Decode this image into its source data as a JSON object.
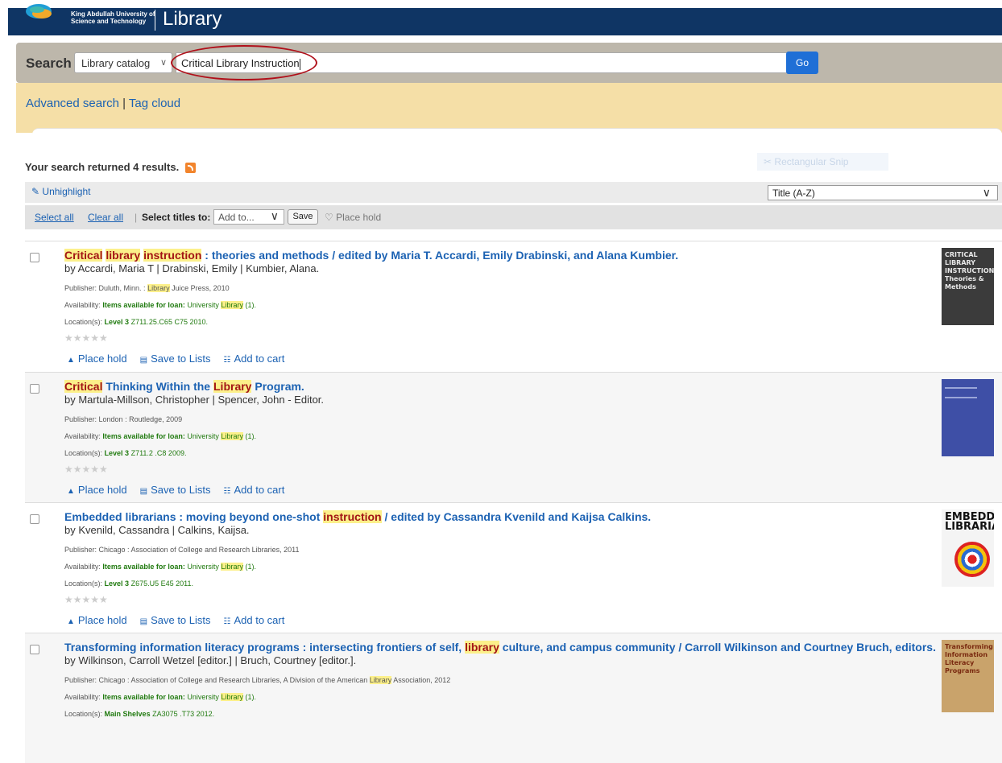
{
  "header": {
    "university": [
      "King Abdullah University of",
      "Science and Technology"
    ],
    "title": "Library"
  },
  "search": {
    "label": "Search",
    "scope": "Library catalog",
    "query": "Critical Library Instruction",
    "go_label": "Go"
  },
  "subnav": {
    "advanced": "Advanced search",
    "separator": "|",
    "tag_cloud": "Tag cloud"
  },
  "results_summary": "Your search returned 4 results.",
  "faded_overlay_text": "Rectangular Snip",
  "toolbar": {
    "unhighlight": "Unhighlight",
    "sort": "Title (A-Z)",
    "select_all": "Select all",
    "clear_all": "Clear all",
    "select_titles_to": "Select titles to:",
    "add_to": "Add to...",
    "save": "Save",
    "place_hold": "Place hold"
  },
  "actions": {
    "place_hold": "Place hold",
    "save_to_lists": "Save to Lists",
    "add_to_cart": "Add to cart"
  },
  "results": [
    {
      "title_parts": [
        {
          "t": "Critical",
          "hl": true
        },
        {
          "t": " ",
          "hl": false
        },
        {
          "t": "library",
          "hl": true
        },
        {
          "t": " ",
          "hl": false
        },
        {
          "t": "instruction",
          "hl": true
        },
        {
          "t": " : theories and methods / edited by Maria T. Accardi, Emily Drabinski, and Alana Kumbier.",
          "hl": false
        }
      ],
      "by": "by Accardi, Maria T | Drabinski, Emily | Kumbier, Alana.",
      "publisher_label": "Publisher:",
      "publisher_parts": [
        " Duluth, Minn. : ",
        "Library",
        " Juice Press, 2010"
      ],
      "availability_label": "Availability:",
      "availability_status": "Items available for loan:",
      "availability_place": [
        " University ",
        "Library",
        " (1)."
      ],
      "location_label": "Location(s):",
      "location_shelf": "Level 3",
      "location_call": " Z711.25.C65 C75 2010.",
      "cover_text": [
        "CRITICAL",
        "LIBRARY",
        "INSTRUCTION",
        "Theories & Methods"
      ],
      "cover_color": "#3b3b3b"
    },
    {
      "title_parts": [
        {
          "t": "Critical",
          "hl": true
        },
        {
          "t": " Thinking Within the ",
          "hl": false
        },
        {
          "t": "Library",
          "hl": true
        },
        {
          "t": " Program.",
          "hl": false
        }
      ],
      "by": "by Martula-Millson, Christopher | Spencer, John - Editor.",
      "publisher_label": "Publisher:",
      "publisher_parts": [
        " London : Routledge, 2009",
        "",
        ""
      ],
      "availability_label": "Availability:",
      "availability_status": "Items available for loan:",
      "availability_place": [
        " University ",
        "Library",
        " (1)."
      ],
      "location_label": "Location(s):",
      "location_shelf": "Level 3",
      "location_call": " Z711.2 .C8 2009.",
      "cover_text": [],
      "cover_color": "#3e4fa6"
    },
    {
      "title_parts": [
        {
          "t": "Embedded librarians : moving beyond one-shot ",
          "hl": false
        },
        {
          "t": "instruction",
          "hl": true
        },
        {
          "t": " / edited by Cassandra Kvenild and Kaijsa Calkins.",
          "hl": false
        }
      ],
      "by": "by Kvenild, Cassandra | Calkins, Kaijsa.",
      "publisher_label": "Publisher:",
      "publisher_parts": [
        " Chicago : Association of College and Research Libraries, 2011",
        "",
        ""
      ],
      "availability_label": "Availability:",
      "availability_status": "Items available for loan:",
      "availability_place": [
        " University ",
        "Library",
        " (1)."
      ],
      "location_label": "Location(s):",
      "location_shelf": "Level 3",
      "location_call": " Z675.U5 E45 2011.",
      "cover_text": [
        "EMBEDDED",
        "LIBRARIANS"
      ],
      "cover_color": "#f4f4f4"
    },
    {
      "title_parts": [
        {
          "t": "Transforming information literacy programs : intersecting frontiers of self, ",
          "hl": false
        },
        {
          "t": "library",
          "hl": true
        },
        {
          "t": " culture, and campus community / Carroll Wilkinson and Courtney Bruch, editors.",
          "hl": false
        }
      ],
      "by": "by Wilkinson, Carroll Wetzel [editor.] | Bruch, Courtney [editor.].",
      "publisher_label": "Publisher:",
      "publisher_parts": [
        " Chicago : Association of College and Research Libraries, A Division of the American ",
        "Library",
        " Association, 2012"
      ],
      "availability_label": "Availability:",
      "availability_status": "Items available for loan:",
      "availability_place": [
        " University ",
        "Library",
        " (1)."
      ],
      "location_label": "Location(s):",
      "location_shelf": "Main Shelves",
      "location_call": " ZA3075 .T73 2012.",
      "cover_text": [
        "Transforming",
        "Information",
        "Literacy",
        "Programs"
      ],
      "cover_color": "#c9a36b"
    }
  ],
  "colors": {
    "header_bg": "#0f3564",
    "search_bg": "#bdb7ab",
    "subnav_bg": "#f5dfa7",
    "link": "#1c62b3",
    "available": "#207a0f",
    "highlight": "#fcf08a",
    "annotation": "#b0101a"
  }
}
